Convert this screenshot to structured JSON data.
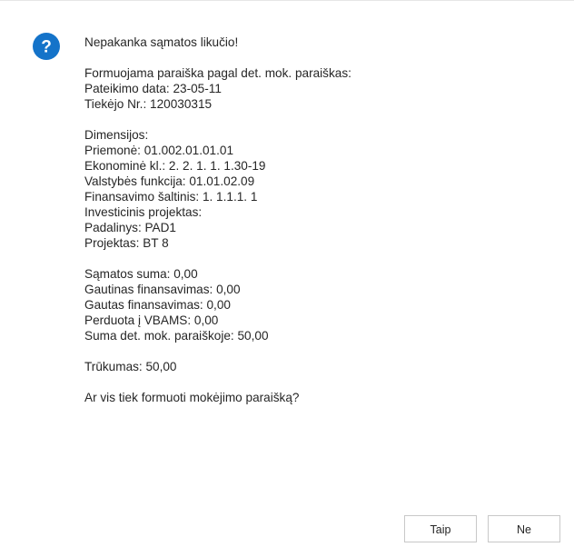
{
  "icon": {
    "name": "question-icon",
    "color": "#1473c9"
  },
  "message": {
    "lines": [
      "Nepakanka sąmatos likučio!",
      "",
      "Formuojama paraiška pagal det. mok. paraiškas:",
      "Pateikimo data: 23-05-11",
      "Tiekėjo Nr.: 120030315",
      "",
      "Dimensijos:",
      "Priemonė: 01.002.01.01.01",
      "Ekonominė kl.: 2. 2. 1. 1. 1.30-19",
      "Valstybės funkcija: 01.01.02.09",
      "Finansavimo šaltinis: 1. 1.1.1. 1",
      "Investicinis projektas:",
      "Padalinys: PAD1",
      "Projektas: BT 8",
      "",
      "Sąmatos suma: 0,00",
      "Gautinas finansavimas: 0,00",
      "Gautas finansavimas: 0,00",
      "Perduota į VBAMS: 0,00",
      "Suma det. mok. paraiškoje: 50,00",
      "",
      "Trūkumas: 50,00",
      "",
      "Ar vis tiek formuoti mokėjimo paraišką?"
    ]
  },
  "buttons": {
    "yes_label": "Taip",
    "no_label": "Ne"
  }
}
